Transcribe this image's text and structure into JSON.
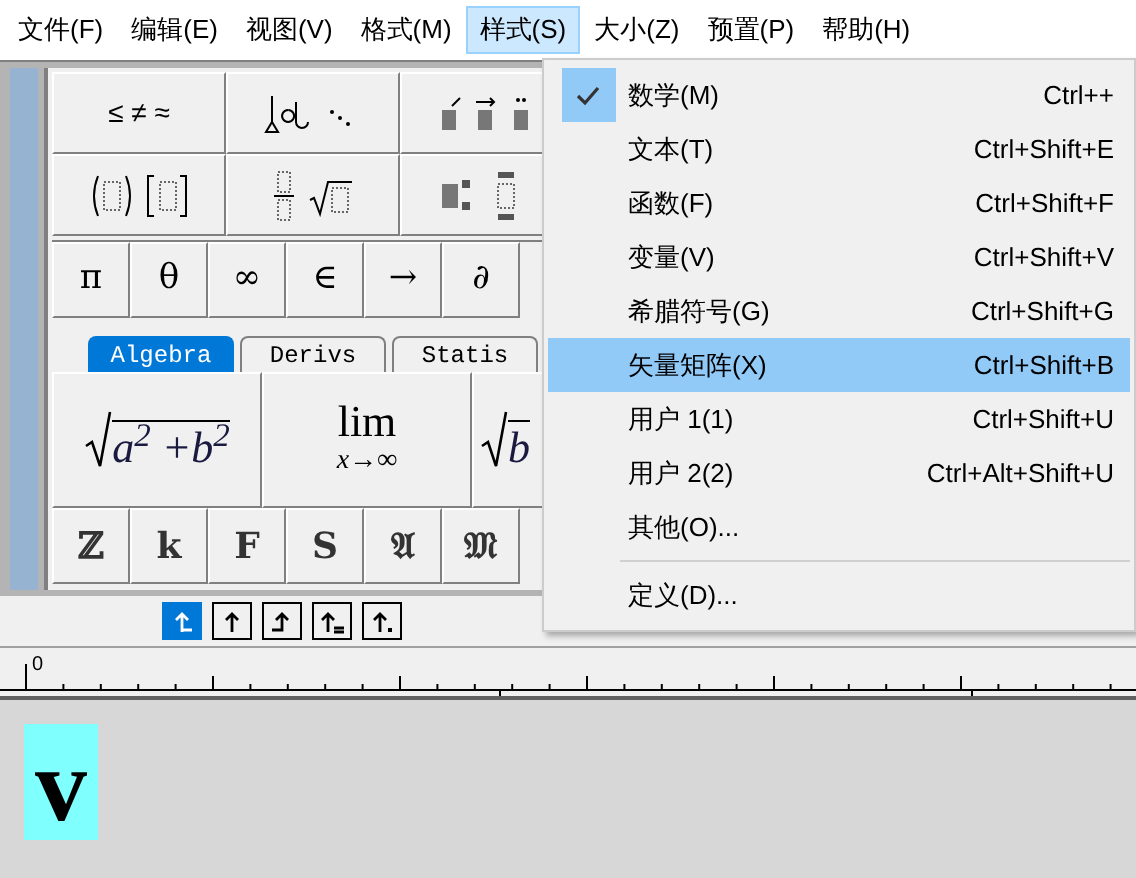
{
  "menubar": [
    {
      "label": "文件(F)",
      "selected": false
    },
    {
      "label": "编辑(E)",
      "selected": false
    },
    {
      "label": "视图(V)",
      "selected": false
    },
    {
      "label": "格式(M)",
      "selected": false
    },
    {
      "label": "样式(S)",
      "selected": true
    },
    {
      "label": "大小(Z)",
      "selected": false
    },
    {
      "label": "预置(P)",
      "selected": false
    },
    {
      "label": "帮助(H)",
      "selected": false
    }
  ],
  "palette": {
    "relations": "≤ ≠ ≈",
    "symbols": [
      "π",
      "θ",
      "∞",
      "∈",
      "→",
      "∂"
    ],
    "tabs": [
      {
        "label": "Algebra",
        "selected": true
      },
      {
        "label": "Derivs",
        "selected": false
      },
      {
        "label": "Statis",
        "selected": false
      }
    ],
    "expressions": [
      {
        "kind": "radical",
        "body": "a$^{2}$ +b$^{2}$"
      },
      {
        "kind": "limit",
        "top": "lim",
        "bottom": "x→∞"
      },
      {
        "kind": "radical",
        "body": "b"
      }
    ],
    "letters": [
      "ℤ",
      "k",
      "F",
      "S",
      "𝔄",
      "𝔐"
    ]
  },
  "nudge_buttons": [
    {
      "kind": "corner",
      "selected": true
    },
    {
      "kind": "up",
      "selected": false
    },
    {
      "kind": "step",
      "selected": false
    },
    {
      "kind": "equals",
      "selected": false
    },
    {
      "kind": "dot",
      "selected": false
    }
  ],
  "ruler": {
    "label": "0"
  },
  "document": {
    "content": "v"
  },
  "menu": {
    "items": [
      {
        "kind": "item",
        "label": "数学(M)",
        "shortcut": "Ctrl++",
        "checked": true,
        "selected": false
      },
      {
        "kind": "item",
        "label": "文本(T)",
        "shortcut": "Ctrl+Shift+E",
        "checked": false,
        "selected": false
      },
      {
        "kind": "item",
        "label": "函数(F)",
        "shortcut": "Ctrl+Shift+F",
        "checked": false,
        "selected": false
      },
      {
        "kind": "item",
        "label": "变量(V)",
        "shortcut": "Ctrl+Shift+V",
        "checked": false,
        "selected": false
      },
      {
        "kind": "item",
        "label": "希腊符号(G)",
        "shortcut": "Ctrl+Shift+G",
        "checked": false,
        "selected": false
      },
      {
        "kind": "item",
        "label": "矢量矩阵(X)",
        "shortcut": "Ctrl+Shift+B",
        "checked": false,
        "selected": true
      },
      {
        "kind": "item",
        "label": "用户 1(1)",
        "shortcut": "Ctrl+Shift+U",
        "checked": false,
        "selected": false
      },
      {
        "kind": "item",
        "label": "用户 2(2)",
        "shortcut": "Ctrl+Alt+Shift+U",
        "checked": false,
        "selected": false
      },
      {
        "kind": "item",
        "label": "其他(O)...",
        "checked": false,
        "selected": false
      },
      {
        "kind": "separator"
      },
      {
        "kind": "item",
        "label": "定义(D)...",
        "checked": false,
        "selected": false
      }
    ]
  }
}
